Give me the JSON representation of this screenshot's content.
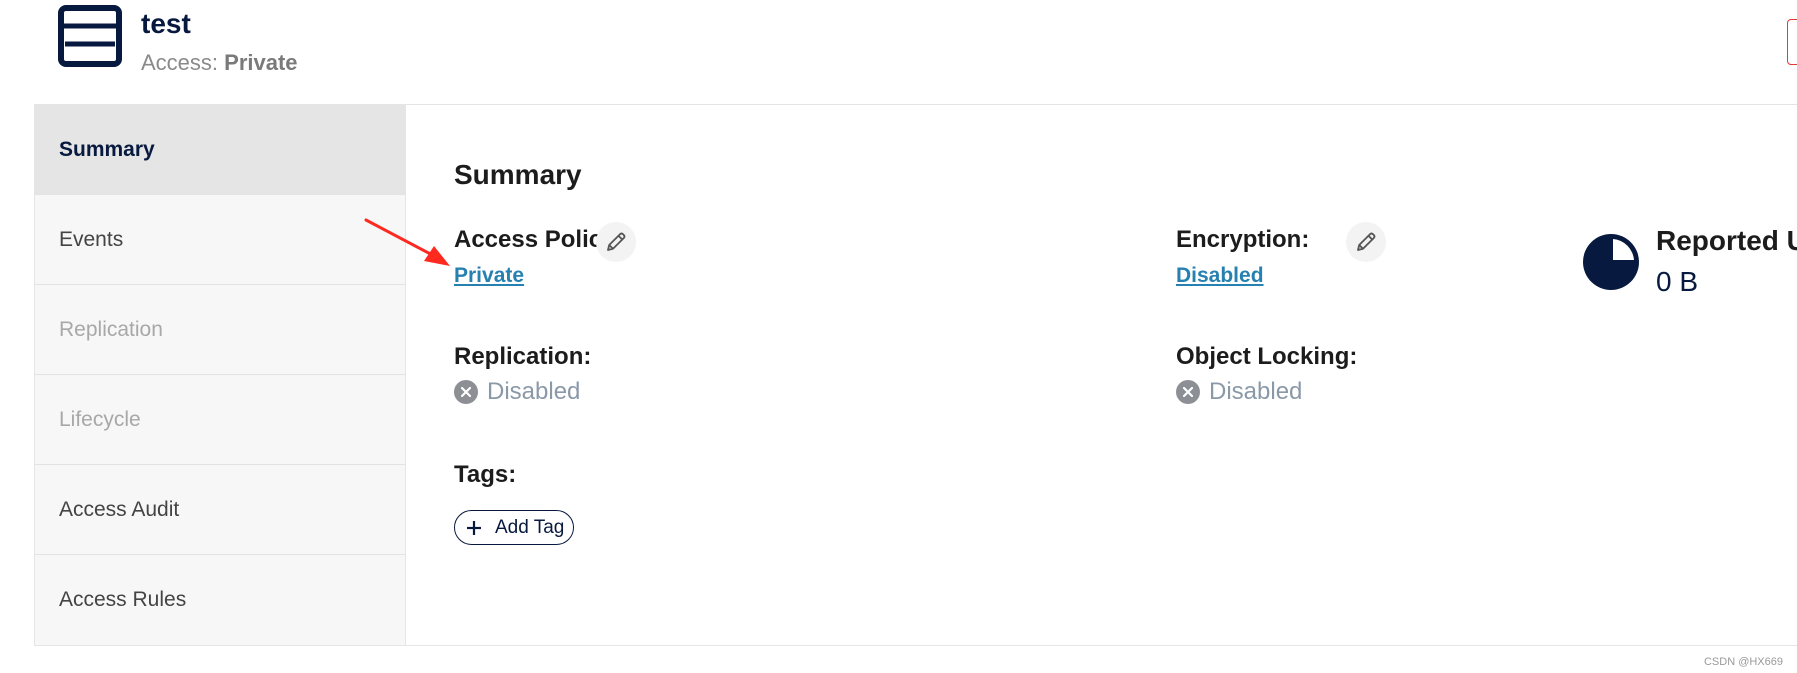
{
  "header": {
    "bucket_name": "test",
    "access_prefix": "Access: ",
    "access_value": "Private"
  },
  "sidebar": {
    "items": [
      {
        "label": "Summary",
        "state": "active"
      },
      {
        "label": "Events",
        "state": "enabled"
      },
      {
        "label": "Replication",
        "state": "disabled"
      },
      {
        "label": "Lifecycle",
        "state": "disabled"
      },
      {
        "label": "Access Audit",
        "state": "enabled"
      },
      {
        "label": "Access Rules",
        "state": "enabled"
      }
    ]
  },
  "summary": {
    "title": "Summary",
    "access_policy": {
      "label": "Access Policy:",
      "value": "Private"
    },
    "encryption": {
      "label": "Encryption:",
      "value": "Disabled"
    },
    "replication": {
      "label": "Replication:",
      "value": "Disabled"
    },
    "object_locking": {
      "label": "Object Locking:",
      "value": "Disabled"
    },
    "tags": {
      "label": "Tags:",
      "add_button": "Add Tag"
    },
    "reported_usage": {
      "label": "Reported Usage:",
      "value": "0 B"
    }
  },
  "colors": {
    "navy": "#07193e",
    "link": "#2781b0",
    "arrow": "#ff2a1f",
    "muted": "#8a99a8"
  },
  "watermark": "CSDN @HX669"
}
